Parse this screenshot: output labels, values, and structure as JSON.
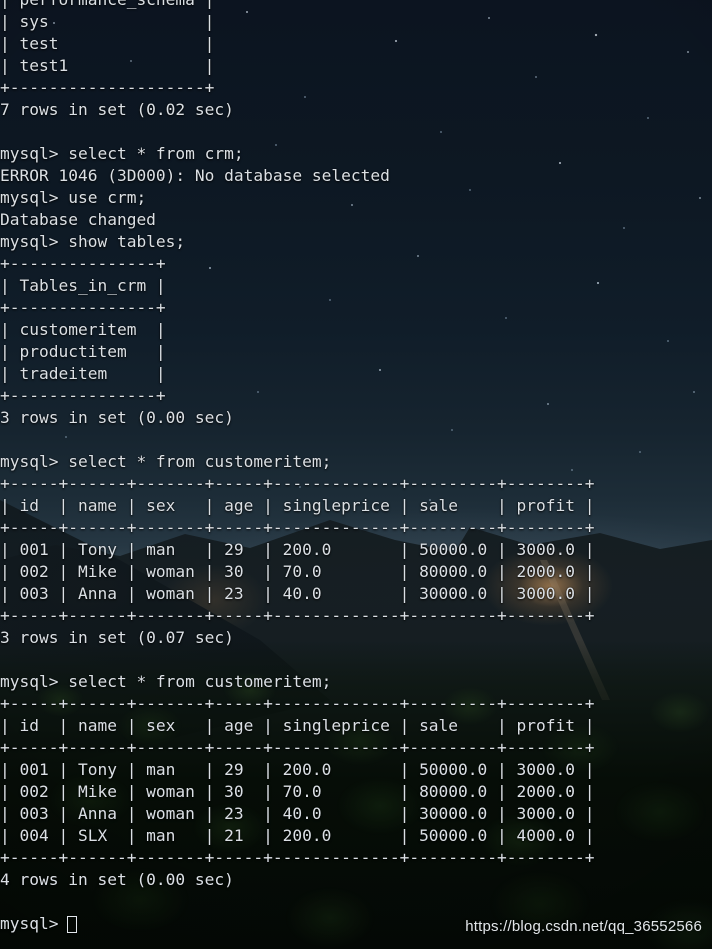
{
  "terminal": {
    "prompt": "mysql>",
    "cursor_char": "block-cursor",
    "text_color": "#dbe0e5",
    "background_color": "#0c1420",
    "lines": [
      "| performance_schema |",
      "| sys                |",
      "| test               |",
      "| test1              |",
      "+--------------------+",
      "7 rows in set (0.02 sec)",
      "",
      "mysql> select * from crm;",
      "ERROR 1046 (3D000): No database selected",
      "mysql> use crm;",
      "Database changed",
      "mysql> show tables;",
      "+---------------+",
      "| Tables_in_crm |",
      "+---------------+",
      "| customeritem  |",
      "| productitem   |",
      "| tradeitem     |",
      "+---------------+",
      "3 rows in set (0.00 sec)",
      "",
      "mysql> select * from customeritem;",
      "+-----+------+-------+-----+-------------+---------+--------+",
      "| id  | name | sex   | age | singleprice | sale    | profit |",
      "+-----+------+-------+-----+-------------+---------+--------+",
      "| 001 | Tony | man   | 29  | 200.0       | 50000.0 | 3000.0 |",
      "| 002 | Mike | woman | 30  | 70.0        | 80000.0 | 2000.0 |",
      "| 003 | Anna | woman | 23  | 40.0        | 30000.0 | 3000.0 |",
      "+-----+------+-------+-----+-------------+---------+--------+",
      "3 rows in set (0.07 sec)",
      "",
      "mysql> select * from customeritem;",
      "+-----+------+-------+-----+-------------+---------+--------+",
      "| id  | name | sex   | age | singleprice | sale    | profit |",
      "+-----+------+-------+-----+-------------+---------+--------+",
      "| 001 | Tony | man   | 29  | 200.0       | 50000.0 | 3000.0 |",
      "| 002 | Mike | woman | 30  | 70.0        | 80000.0 | 2000.0 |",
      "| 003 | Anna | woman | 23  | 40.0        | 30000.0 | 3000.0 |",
      "| 004 | SLX  | man   | 21  | 200.0       | 50000.0 | 4000.0 |",
      "+-----+------+-------+-----+-------------+---------+--------+",
      "4 rows in set (0.00 sec)",
      "",
      "mysql> "
    ]
  },
  "databases_result": {
    "visible_rows": [
      "performance_schema",
      "sys",
      "test",
      "test1"
    ],
    "status": "7 rows in set (0.02 sec)"
  },
  "commands": {
    "select_crm": "mysql> select * from crm;",
    "error": "ERROR 1046 (3D000): No database selected",
    "use_crm": "mysql> use crm;",
    "database_changed": "Database changed",
    "show_tables": "mysql> show tables;",
    "select_customeritem": "mysql> select * from customeritem;"
  },
  "tables_result": {
    "header": "Tables_in_crm",
    "rows": [
      "customeritem",
      "productitem",
      "tradeitem"
    ],
    "status": "3 rows in set (0.00 sec)"
  },
  "customeritem_first": {
    "columns": [
      "id",
      "name",
      "sex",
      "age",
      "singleprice",
      "sale",
      "profit"
    ],
    "rows": [
      [
        "001",
        "Tony",
        "man",
        "29",
        "200.0",
        "50000.0",
        "3000.0"
      ],
      [
        "002",
        "Mike",
        "woman",
        "30",
        "70.0",
        "80000.0",
        "2000.0"
      ],
      [
        "003",
        "Anna",
        "woman",
        "23",
        "40.0",
        "30000.0",
        "3000.0"
      ]
    ],
    "status": "3 rows in set (0.07 sec)"
  },
  "customeritem_second": {
    "columns": [
      "id",
      "name",
      "sex",
      "age",
      "singleprice",
      "sale",
      "profit"
    ],
    "rows": [
      [
        "001",
        "Tony",
        "man",
        "29",
        "200.0",
        "50000.0",
        "3000.0"
      ],
      [
        "002",
        "Mike",
        "woman",
        "30",
        "70.0",
        "80000.0",
        "2000.0"
      ],
      [
        "003",
        "Anna",
        "woman",
        "23",
        "40.0",
        "30000.0",
        "3000.0"
      ],
      [
        "004",
        "SLX",
        "man",
        "21",
        "200.0",
        "50000.0",
        "4000.0"
      ]
    ],
    "status": "4 rows in set (0.00 sec)"
  },
  "watermark": {
    "url": "https://blog.csdn.net/qq_36552566"
  }
}
